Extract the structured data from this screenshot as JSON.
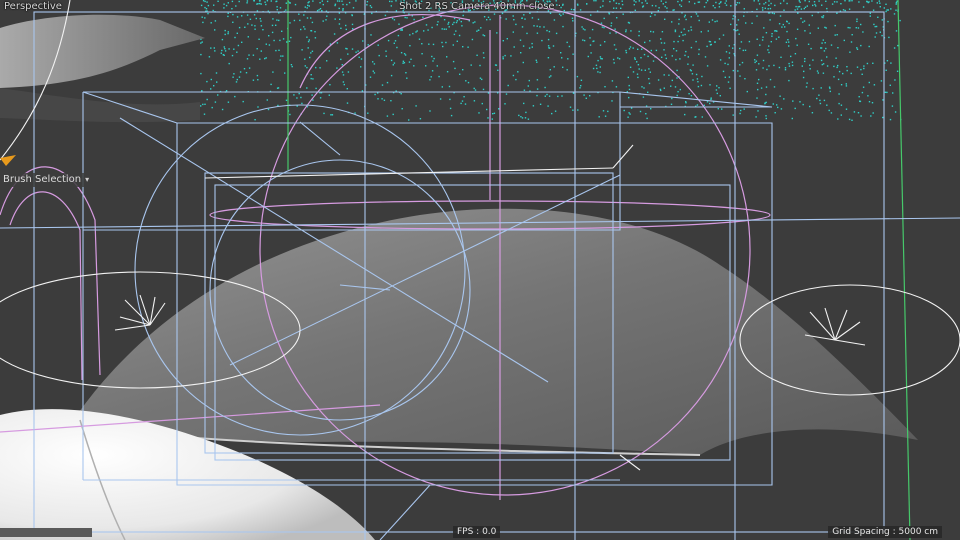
{
  "viewport": {
    "view_name": "Perspective",
    "camera_label": "Shot 2 RS Camera 40mm close",
    "camera_menu_glyph": "·",
    "brush_selection_label": "Brush Selection",
    "brush_selection_icon": "chevron-down-icon",
    "fps_text": "FPS : 0.0",
    "grid_spacing_text": "Grid Spacing : 5000 cm"
  },
  "colors": {
    "background": "#3c3c3c",
    "wireframe_blue": "#a9c6ee",
    "light_pink": "#d69be0",
    "particle_cyan": "#2fd0c8",
    "guide_green": "#46c86a",
    "white_lines": "#f2f2f2",
    "surface_grey": "#8f8f8f"
  }
}
